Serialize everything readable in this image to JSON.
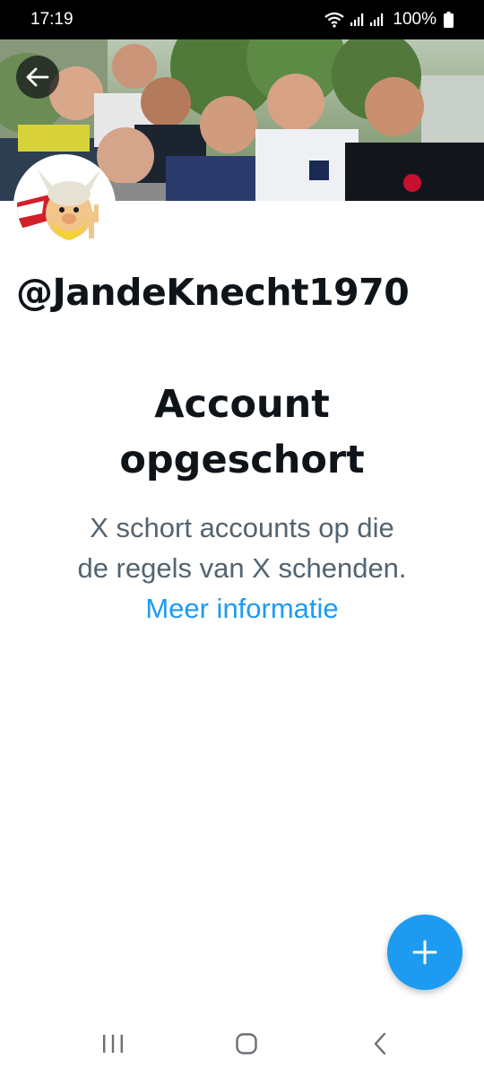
{
  "status_bar": {
    "time": "17:19",
    "battery_percent": "100%",
    "icons": [
      "wifi-icon",
      "signal-icon",
      "signal-icon",
      "battery-icon"
    ]
  },
  "header": {
    "back_icon": "arrow-left-icon",
    "banner_image": "group-photo",
    "avatar_image": "cartoon-avatar"
  },
  "profile": {
    "handle": "@JandeKnecht1970"
  },
  "suspension": {
    "title_line1": "Account",
    "title_line2": "opgeschort",
    "body_line1": "X schort accounts op die",
    "body_line2": "de regels van X schenden.",
    "link_text": "Meer informatie"
  },
  "fab": {
    "icon": "plus-icon"
  },
  "nav_bar": {
    "icons": [
      "recent-apps-icon",
      "home-icon",
      "back-icon"
    ]
  },
  "colors": {
    "accent": "#1d9bf0",
    "text_primary": "#0f1419",
    "text_secondary": "#536471"
  }
}
